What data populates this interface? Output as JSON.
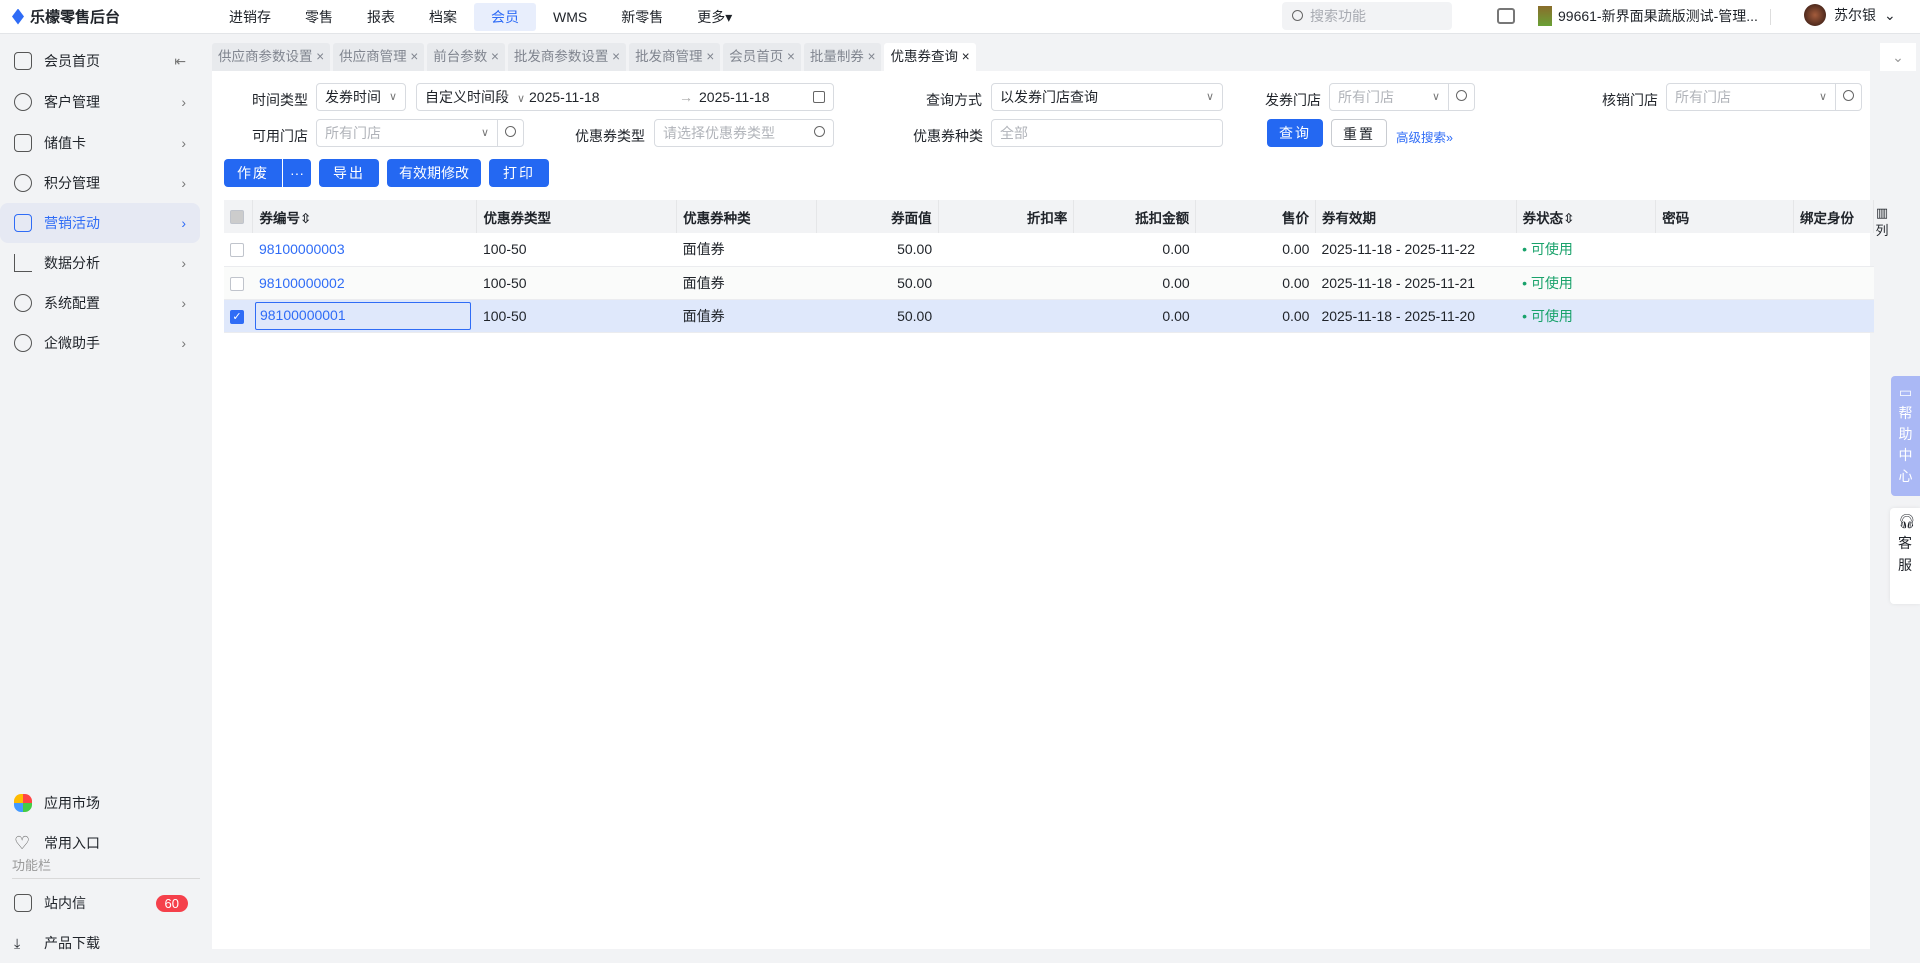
{
  "app": {
    "title": "乐檬零售后台"
  },
  "top_nav": [
    "进销存",
    "零售",
    "报表",
    "档案",
    "会员",
    "WMS",
    "新零售",
    "更多▾"
  ],
  "search": {
    "placeholder": "搜索功能"
  },
  "store": "99661-新界面果蔬版测试-管理...",
  "user": "苏尔银",
  "sidebar": {
    "items": [
      "会员首页",
      "客户管理",
      "储值卡",
      "积分管理",
      "营销活动",
      "数据分析",
      "系统配置",
      "企微助手"
    ],
    "bottom": [
      "应用市场",
      "常用入口"
    ],
    "section": "功能栏",
    "msg": "站内信",
    "msg_count": "60",
    "download": "产品下载"
  },
  "tabs": [
    "供应商参数设置",
    "供应商管理",
    "前台参数",
    "批发商参数设置",
    "批发商管理",
    "会员首页",
    "批量制券",
    "优惠券查询"
  ],
  "filters": {
    "time_type_label": "时间类型",
    "time_type": "发券时间",
    "range_type": "自定义时间段",
    "date_from": "2025-11-18",
    "date_to": "2025-11-18",
    "query_mode_label": "查询方式",
    "query_mode": "以发券门店查询",
    "issue_store_label": "发券门店",
    "issue_store_ph": "所有门店",
    "verify_store_label": "核销门店",
    "verify_store_ph": "所有门店",
    "avail_store_label": "可用门店",
    "avail_store_ph": "所有门店",
    "coupon_type_label": "优惠券类型",
    "coupon_type_ph": "请选择优惠券类型",
    "coupon_kind_label": "优惠券种类",
    "coupon_kind_ph": "全部",
    "query": "查询",
    "reset": "重置",
    "advanced": "高级搜索»"
  },
  "actions": {
    "void": "作废",
    "more": "···",
    "export": "导出",
    "modify": "有效期修改",
    "print": "打印"
  },
  "table": {
    "headers": [
      "券编号⇳",
      "优惠券类型",
      "优惠券种类",
      "券面值",
      "折扣率",
      "抵扣金额",
      "售价",
      "券有效期",
      "券状态⇳",
      "密码",
      "绑定身份"
    ],
    "rows": [
      {
        "code": "98100000003",
        "type": "100-50",
        "kind": "面值券",
        "face": "50.00",
        "rate": "",
        "deduct": "0.00",
        "price": "0.00",
        "valid": "2025-11-18 - 2025-11-22",
        "status": "• 可使用",
        "checked": false
      },
      {
        "code": "98100000002",
        "type": "100-50",
        "kind": "面值券",
        "face": "50.00",
        "rate": "",
        "deduct": "0.00",
        "price": "0.00",
        "valid": "2025-11-18 - 2025-11-21",
        "status": "• 可使用",
        "checked": false
      },
      {
        "code": "98100000001",
        "type": "100-50",
        "kind": "面值券",
        "face": "50.00",
        "rate": "",
        "deduct": "0.00",
        "price": "0.00",
        "valid": "2025-11-18 - 2025-11-20",
        "status": "• 可使用",
        "checked": true
      }
    ]
  },
  "columns_btn": "列",
  "help": "帮助中心",
  "service": "客服"
}
